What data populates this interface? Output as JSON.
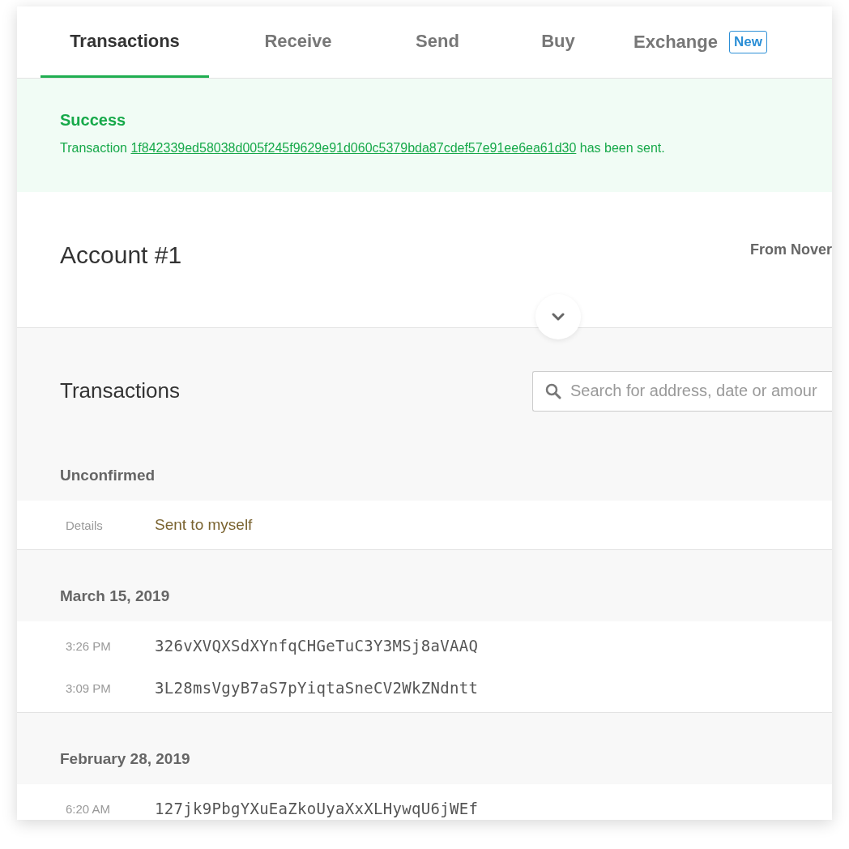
{
  "tabs": [
    {
      "label": "Transactions",
      "selected": true
    },
    {
      "label": "Receive",
      "selected": false
    },
    {
      "label": "Send",
      "selected": false
    },
    {
      "label": "Buy",
      "selected": false
    },
    {
      "label": "Exchange",
      "selected": false,
      "badge": "New"
    }
  ],
  "alert": {
    "kind": "success",
    "title": "Success",
    "before": "Transaction",
    "link": "1f842339ed58038d005f245f9629e91d060c5379bda87cdef57e91ee6ea61d30",
    "after": "has been sent."
  },
  "account": {
    "title": "Account #1",
    "range": "From Nover"
  },
  "transactions": {
    "title": "Transactions",
    "search": {
      "placeholder": "Search for address, date or amour"
    },
    "groups": [
      {
        "heading": "Unconfirmed",
        "rows": [
          {
            "kind": "note",
            "label": "Details",
            "text": "Sent to myself"
          }
        ]
      },
      {
        "heading": "March 15, 2019",
        "rows": [
          {
            "kind": "address",
            "label": "3:26 PM",
            "text": "326vXVQXSdXYnfqCHGeTuC3Y3MSj8aVAAQ"
          },
          {
            "kind": "address",
            "label": "3:09 PM",
            "text": "3L28msVgyB7aS7pYiqtaSneCV2WkZNdntt"
          }
        ]
      },
      {
        "heading": "February 28, 2019",
        "rows": [
          {
            "kind": "address",
            "label": "6:20 AM",
            "text": "127jk9PbgYXuEaZkoUyaXxXLHywqU6jWEf"
          }
        ]
      }
    ]
  }
}
